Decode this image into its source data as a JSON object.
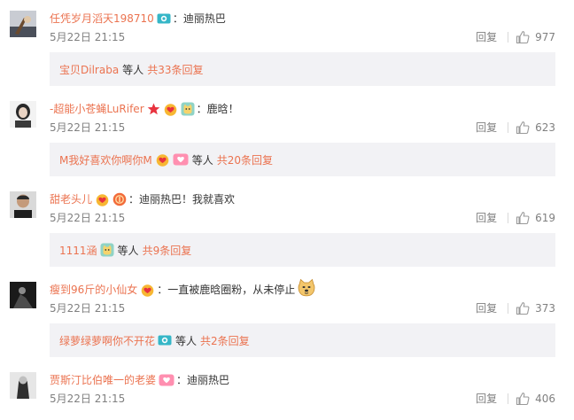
{
  "comments": [
    {
      "username": "任凭岁月滔天198710",
      "badges": [
        "camera-icon"
      ],
      "text": "：迪丽热巴",
      "time": "5月22日 21:15",
      "reply_label": "回复",
      "likes": "977",
      "sub": {
        "user": "宝贝Dilraba",
        "user_badges": [],
        "etc": "等人",
        "total": "共33条回复"
      }
    },
    {
      "username": "-超能小苍蝇LuRifer",
      "badges": [
        "star-icon",
        "heart-hands-icon",
        "cat-icon"
      ],
      "text": "：鹿晗！",
      "time": "5月22日 21:15",
      "reply_label": "回复",
      "likes": "623",
      "sub": {
        "user": "M我好喜欢你啊你M",
        "user_badges": [
          "heart-hands-icon",
          "heart-icon"
        ],
        "etc": "等人",
        "total": "共20条回复"
      }
    },
    {
      "username": "甜老头儿",
      "badges": [
        "heart-hands-icon",
        "fan-badge-icon"
      ],
      "text": "：迪丽热巴！我就喜欢",
      "time": "5月22日 21:15",
      "reply_label": "回复",
      "likes": "619",
      "sub": {
        "user": "1111涵",
        "user_badges": [
          "cat-icon"
        ],
        "etc": "等人",
        "total": "共9条回复"
      }
    },
    {
      "username": "瘦到96斤的小仙女",
      "badges": [
        "heart-hands-icon"
      ],
      "text": "：一直被鹿晗圈粉，从未停止",
      "text_emoji": "doge-emoji",
      "time": "5月22日 21:15",
      "reply_label": "回复",
      "likes": "373",
      "sub": {
        "user": "绿萝绿萝啊你不开花",
        "user_badges": [
          "camera-icon"
        ],
        "etc": "等人",
        "total": "共2条回复"
      }
    },
    {
      "username": "贾斯汀比伯唯一的老婆",
      "badges": [
        "heart-icon"
      ],
      "text": "：迪丽热巴",
      "time": "5月22日 21:15",
      "reply_label": "回复",
      "likes": "406"
    }
  ],
  "colors": {
    "username": "#eb7350",
    "meta": "#808080",
    "text": "#333333",
    "sub_background": "#f2f2f5"
  }
}
